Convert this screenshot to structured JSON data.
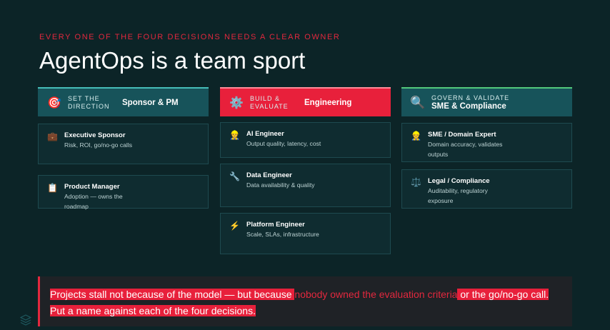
{
  "eyebrow": "EVERY ONE OF THE FOUR DECISIONS NEEDS A CLEAR OWNER",
  "title": "AgentOps is a team sport",
  "columns": [
    {
      "icon": "target-icon",
      "kicker": "SET THE DIRECTION",
      "label": "Sponsor & PM",
      "color": "#17535a",
      "roles": [
        {
          "icon": "briefcase-icon",
          "name": "Executive Sponsor",
          "desc": "Risk, ROI, go/no-go calls"
        },
        {
          "icon": "clipboard-icon",
          "name": "Product Manager",
          "desc": "Adoption — owns the roadmap"
        }
      ]
    },
    {
      "icon": "gear-icon",
      "kicker": "BUILD & EVALUATE",
      "label": "Engineering",
      "color": "#e8203b",
      "roles": [
        {
          "icon": "engineer-icon",
          "name": "AI Engineer",
          "desc": "Output quality, latency, cost"
        },
        {
          "icon": "wrench-icon",
          "name": "Data Engineer",
          "desc": "Data availability & quality"
        },
        {
          "icon": "lightning-icon",
          "name": "Platform Engineer",
          "desc": "Scale, SLAs, infrastructure"
        }
      ]
    },
    {
      "icon": "magnifier-icon",
      "kicker": "GOVERN & VALIDATE",
      "label": "SME & Compliance",
      "color": "#17535a",
      "roles": [
        {
          "icon": "expert-icon",
          "name": "SME / Domain Expert",
          "desc": "Domain accuracy, validates outputs"
        },
        {
          "icon": "scales-icon",
          "name": "Legal / Compliance",
          "desc": "Auditability, regulatory exposure"
        }
      ]
    }
  ],
  "callout": {
    "part1": "Projects stall not because of the model — but because ",
    "part2": "nobody owned the evaluation criteria",
    "part3": " or the go/no-go call. Put a name against each of the four decisions."
  },
  "colors": {
    "accent": "#e2283e",
    "background": "#0c2427",
    "teal": "#17535a"
  },
  "logo_icon": "stack-layers-icon"
}
